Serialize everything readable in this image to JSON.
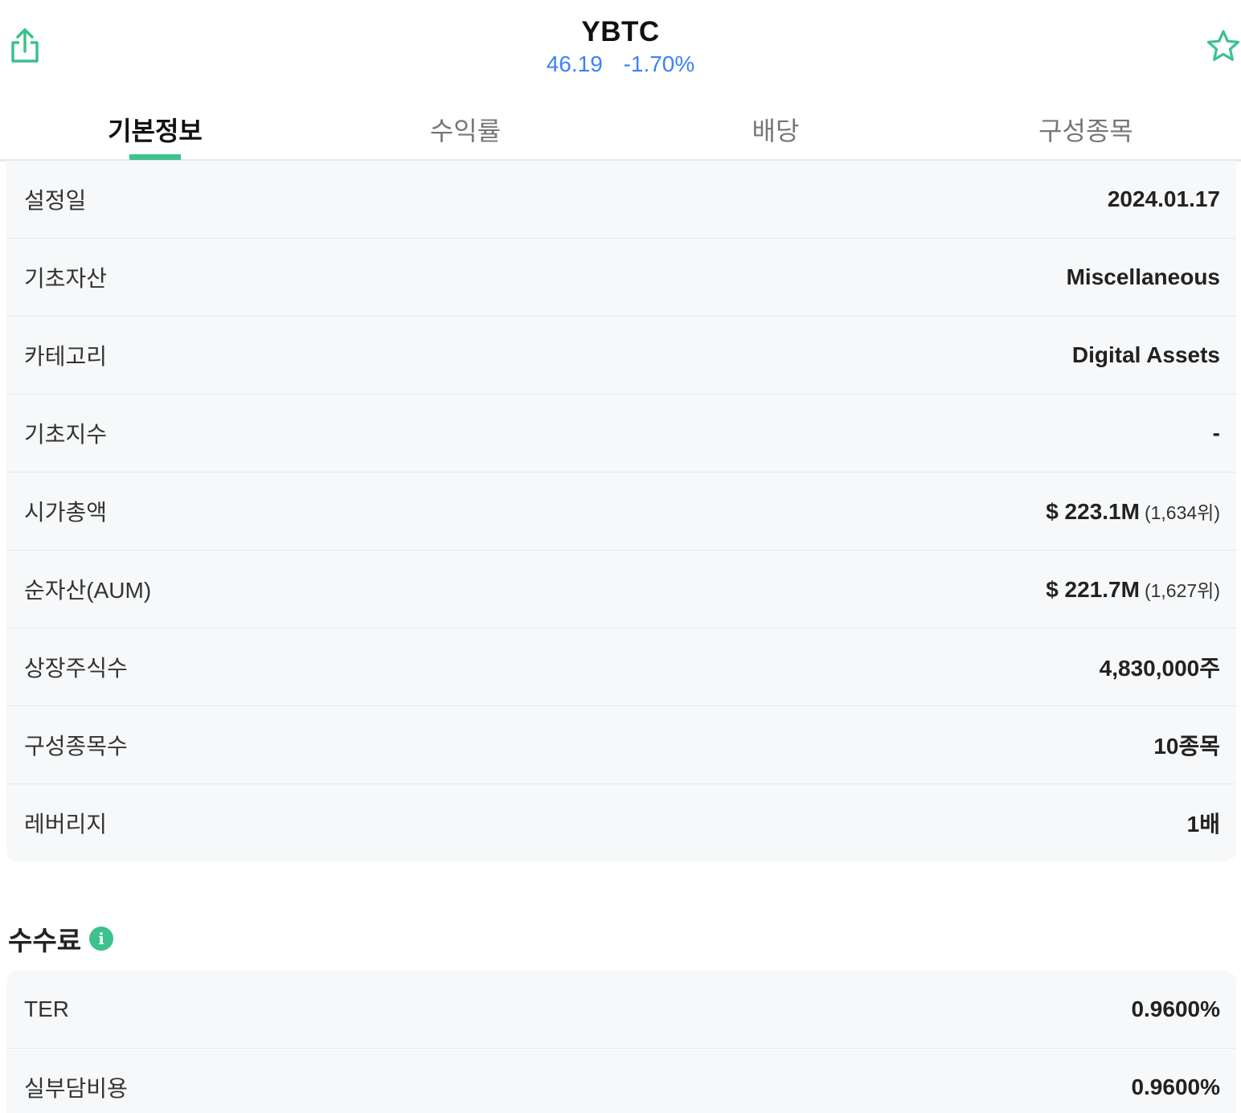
{
  "header": {
    "ticker": "YBTC",
    "price": "46.19",
    "change": "-1.70%",
    "share_icon": "share-icon",
    "favorite_icon": "star-outline-icon",
    "accent_color": "#3cc18f",
    "quote_color": "#3b82f6"
  },
  "tabs": [
    {
      "label": "기본정보",
      "active": true
    },
    {
      "label": "수익률",
      "active": false
    },
    {
      "label": "배당",
      "active": false
    },
    {
      "label": "구성종목",
      "active": false
    }
  ],
  "info": {
    "rows": [
      {
        "label": "설정일",
        "value": "2024.01.17",
        "rank": ""
      },
      {
        "label": "기초자산",
        "value": "Miscellaneous",
        "rank": ""
      },
      {
        "label": "카테고리",
        "value": "Digital Assets",
        "rank": ""
      },
      {
        "label": "기초지수",
        "value": "-",
        "rank": ""
      },
      {
        "label": "시가총액",
        "value": "$ 223.1M",
        "rank": "(1,634위)"
      },
      {
        "label": "순자산(AUM)",
        "value": "$ 221.7M",
        "rank": "(1,627위)"
      },
      {
        "label": "상장주식수",
        "value": "4,830,000주",
        "rank": ""
      },
      {
        "label": "구성종목수",
        "value": "10종목",
        "rank": ""
      },
      {
        "label": "레버리지",
        "value": "1배",
        "rank": ""
      }
    ]
  },
  "fees": {
    "heading": "수수료",
    "info_icon": "info-icon",
    "rows": [
      {
        "label": "TER",
        "value": "0.9600%"
      },
      {
        "label": "실부담비용",
        "value": "0.9600%"
      }
    ]
  }
}
